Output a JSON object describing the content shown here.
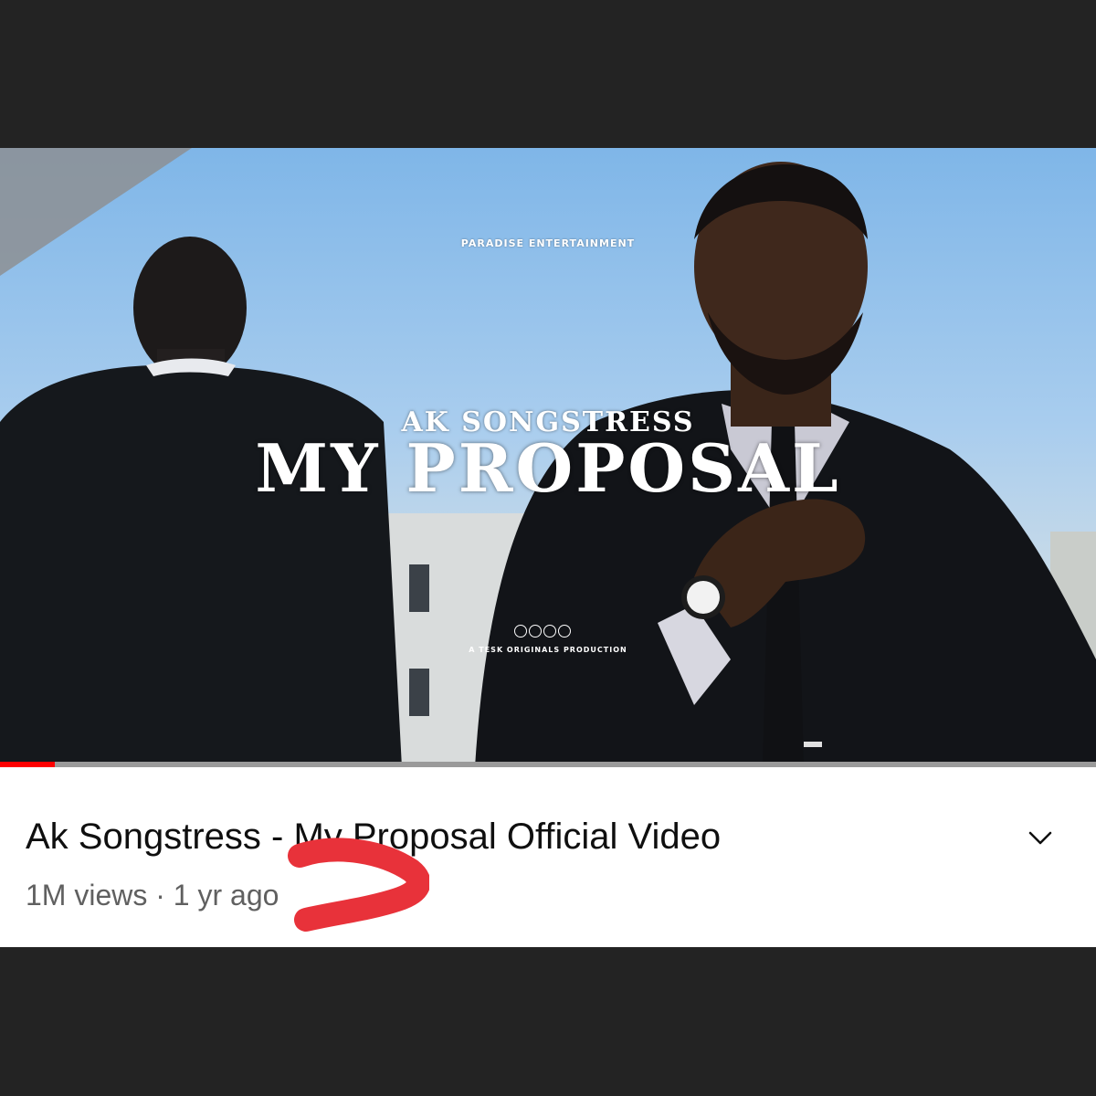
{
  "video": {
    "overlay": {
      "brand": "PARADISE ENTERTAINMENT",
      "artist": "AK SONGSTRESS",
      "song": "MY PROPOSAL",
      "production": "A TESK ORIGINALS PRODUCTION"
    },
    "progress_fraction": 0.05,
    "progress_color": "#ff0000"
  },
  "info": {
    "title": "Ak Songstress - My Proposal Official Video",
    "views": "1M views",
    "separator": "·",
    "age": "1 yr ago",
    "expand_icon": "chevron-down-icon"
  },
  "annotation": {
    "icon": "red-marker-scribble",
    "color": "#e8323a"
  }
}
